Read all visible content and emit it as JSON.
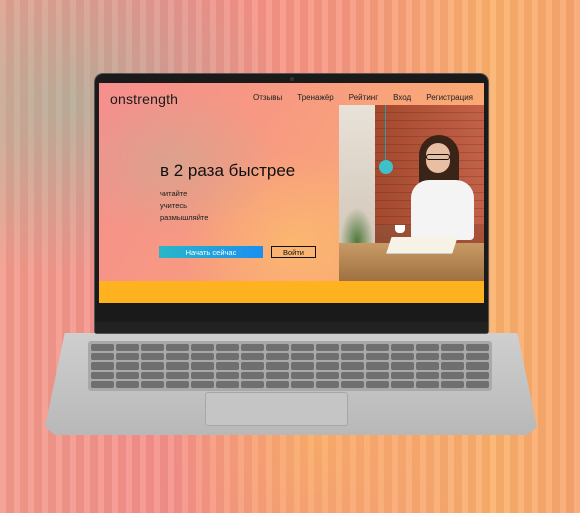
{
  "site": {
    "logo": "onstrength",
    "nav": [
      "Отзывы",
      "Тренажёр",
      "Рейтинг",
      "Вход",
      "Регистрация"
    ]
  },
  "hero": {
    "headline": "в 2 раза быстрее",
    "lines": [
      "читайте",
      "учитесь",
      "размышляйте"
    ],
    "primary_button": "Начать сейчас",
    "secondary_button": "Войти"
  },
  "colors": {
    "accent": "#1a8ff0",
    "stripe": "#ffb21f"
  }
}
